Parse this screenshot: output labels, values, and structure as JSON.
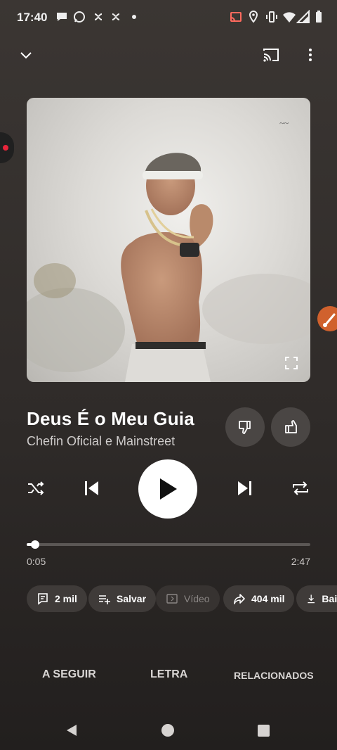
{
  "status_bar": {
    "time": "17:40"
  },
  "player": {
    "title": "Deus É o Meu Guia",
    "artist": "Chefin Oficial e Mainstreet",
    "current_time": "0:05",
    "total_time": "2:47",
    "progress": 0.03
  },
  "chips": [
    {
      "label": "2 mil",
      "icon": "comment-icon"
    },
    {
      "label": "Salvar",
      "icon": "playlist-add-icon"
    },
    {
      "label": "Vídeo",
      "icon": "video-icon"
    },
    {
      "label": "404 mil",
      "icon": "share-icon"
    },
    {
      "label": "Baix",
      "icon": "download-icon"
    }
  ],
  "tabs": {
    "next": "A SEGUIR",
    "lyrics": "LETRA",
    "related": "RELACIONADOS"
  },
  "colors": {
    "background": "#2f2b29",
    "accent_bubble": "#d0612d",
    "record_dot": "#e8253b"
  }
}
